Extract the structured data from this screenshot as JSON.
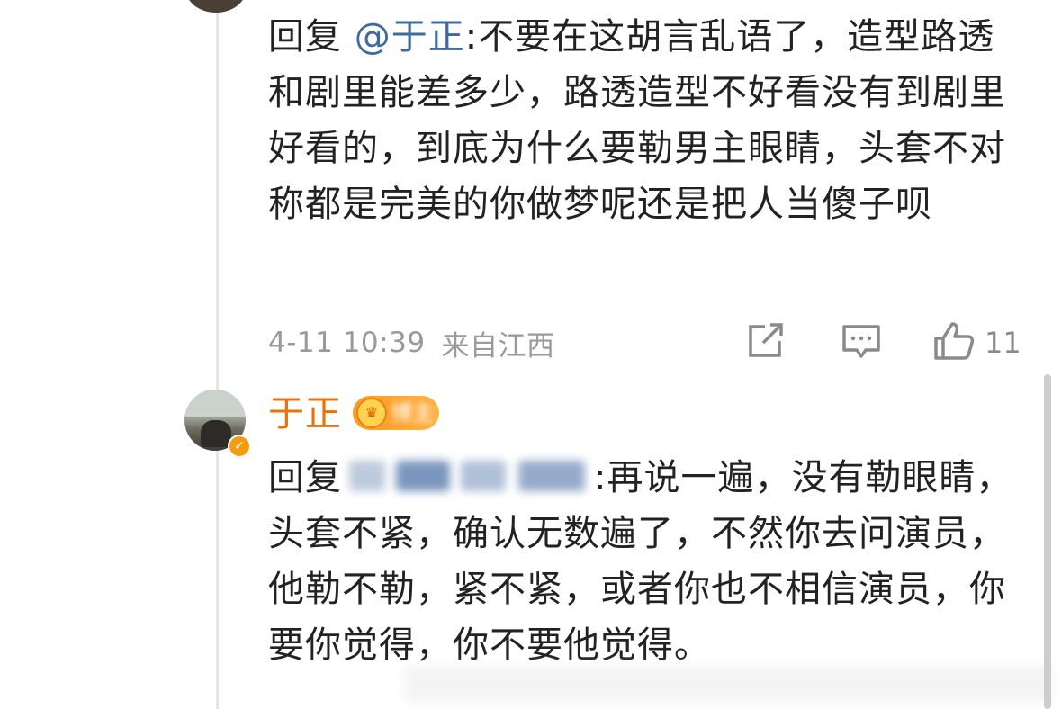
{
  "comment1": {
    "prefix": "回复",
    "mention": "@于正",
    "body": ":不要在这胡言乱语了，造型路透和剧里能差多少，路透造型不好看没有到剧里好看的，到底为什么要勒男主眼睛，头套不对称都是完美的你做梦呢还是把人当傻子呗",
    "timestamp": "4-11 10:39",
    "location": "来自江西",
    "like_count": "11"
  },
  "comment2": {
    "username": "于正",
    "badge_label": "博主",
    "prefix": "回复",
    "body": ":再说一遍，没有勒眼睛，头套不紧，确认无数遍了，不然你去问演员，他勒不勒，紧不紧，或者你也不相信演员，你要你觉得，你不要他觉得。"
  },
  "icons": {
    "share": "share-icon",
    "reply": "comment-icon",
    "like": "thumbs-up-icon",
    "verified": "verified-badge-icon"
  },
  "colors": {
    "mention": "#3d6aa0",
    "username": "#e8730c",
    "meta": "#9a9a9a"
  }
}
